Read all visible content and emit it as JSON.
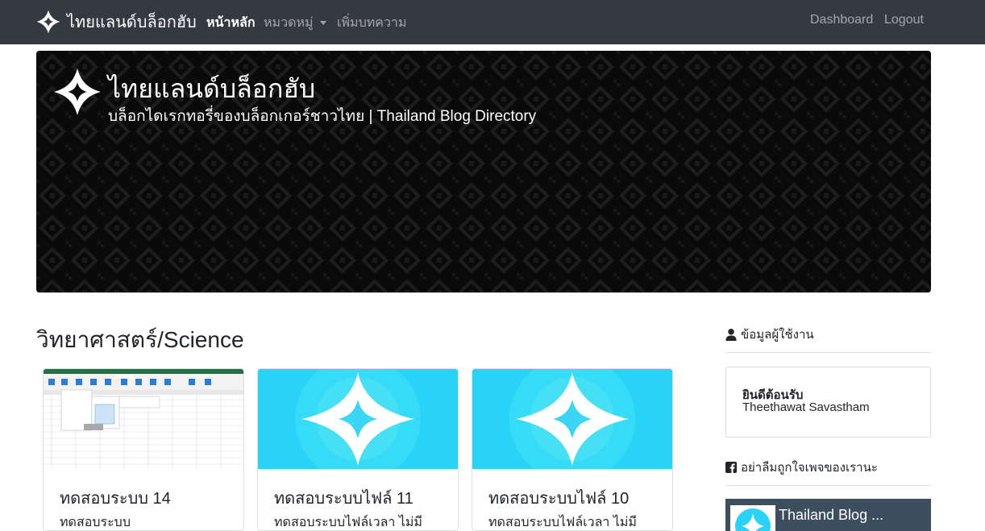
{
  "navbar": {
    "brand": "ไทยแลนด์บล็อกฮับ",
    "links": [
      "หน้าหลัก",
      "หมวดหมู่",
      "เพิ่มบทความ"
    ],
    "right_links": [
      "Dashboard",
      "Logout"
    ]
  },
  "hero": {
    "title": "ไทยแลนด์บล็อกฮับ",
    "subtitle": "บล็อกไดเรกทอรี่ของบล็อกเกอร์ชาวไทย | Thailand Blog Directory"
  },
  "main": {
    "section_title": "วิทยาศาสตร์/Science",
    "cards": [
      {
        "title": "ทดสอบระบบ 14",
        "excerpt": "ทดสอบระบบ",
        "image": "spreadsheet-screenshot"
      },
      {
        "title": "ทดสอบระบบไฟล์ 11",
        "excerpt": "ทดสอบระบบไฟล์เวลา ไม่มี",
        "image": "logo-placeholder"
      },
      {
        "title": "ทดสอบระบบไฟล์ 10",
        "excerpt": "ทดสอบระบบไฟล์เวลา ไม่มี",
        "image": "logo-placeholder"
      }
    ]
  },
  "sidebar": {
    "user_heading": "ข้อมูลผู้ใช้งาน",
    "welcome_title": "ยินดีต้อนรับ",
    "user_name": "Theethawat Savastham",
    "facebook_heading": "อย่าลืมถูกใจเพจของเรานะ",
    "facebook_page_title": "Thailand Blog ..."
  },
  "colors": {
    "navbar_bg": "#343a40",
    "card_image_bg": "#29d2f7",
    "hero_bg": "#0a0a0a"
  }
}
